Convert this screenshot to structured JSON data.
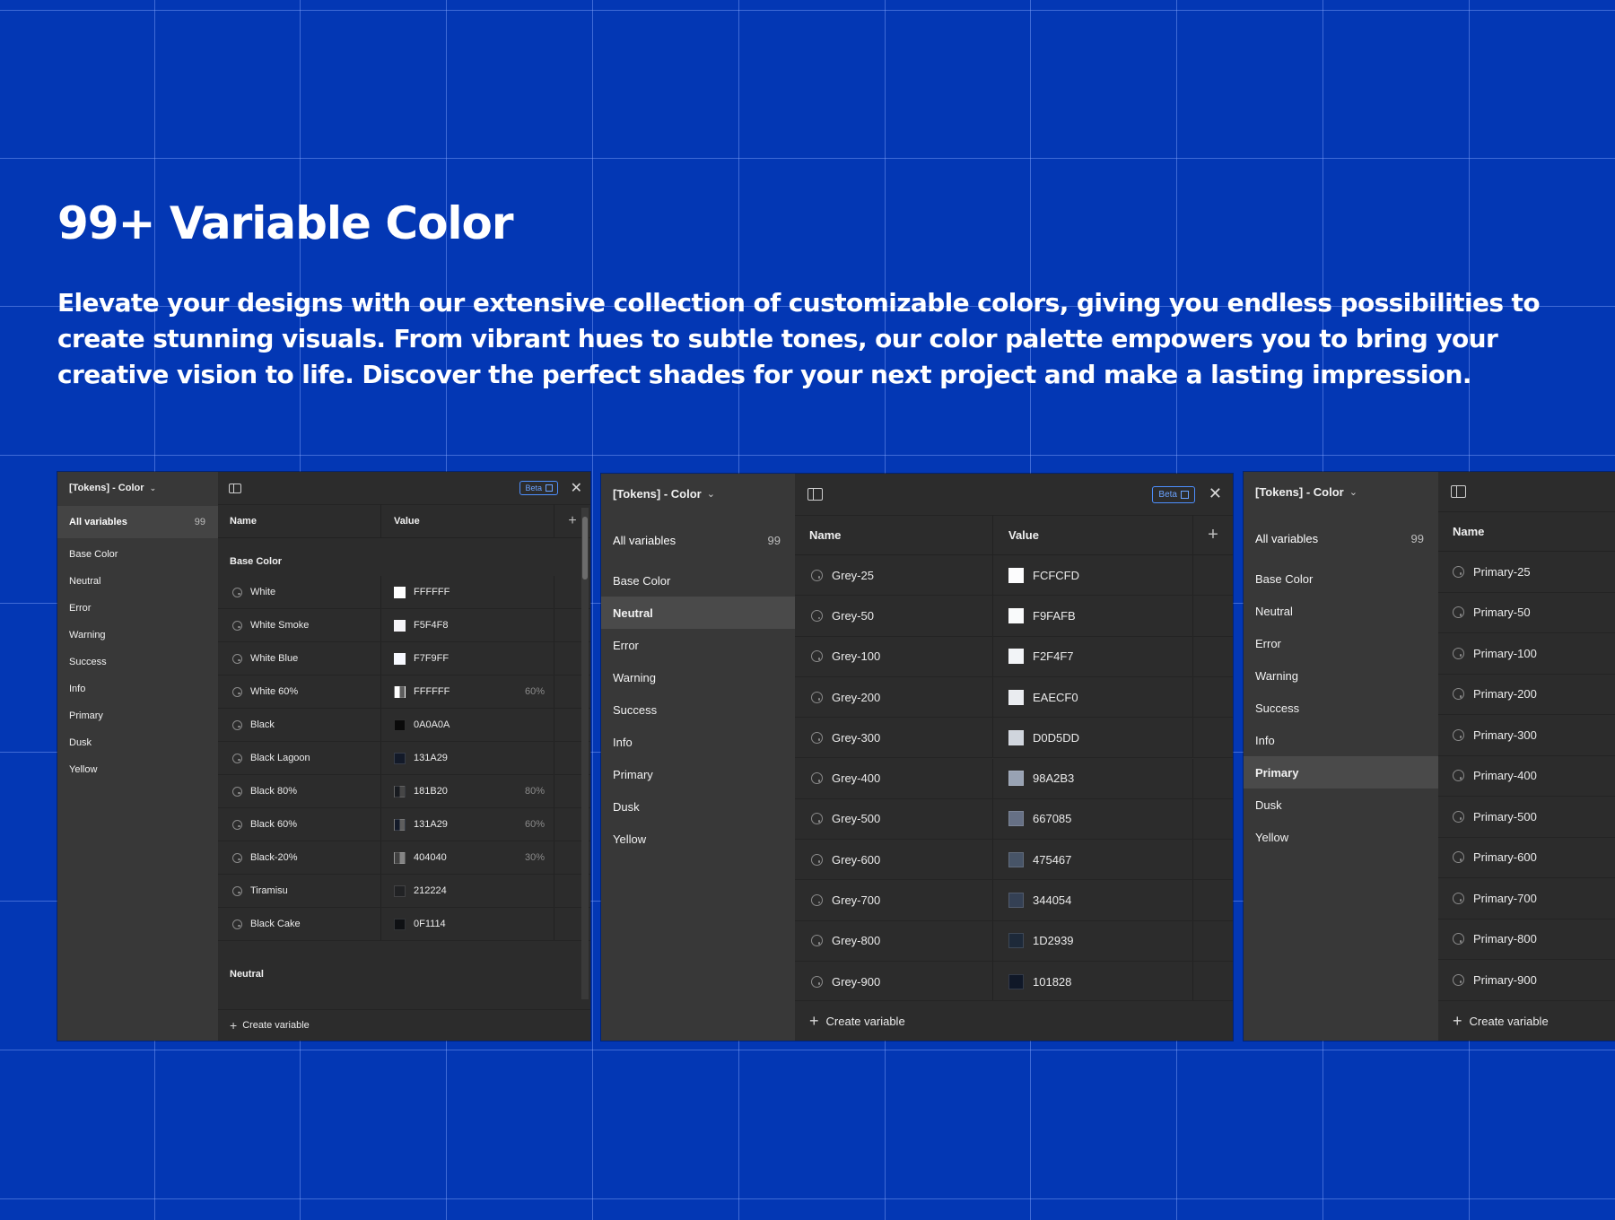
{
  "hero": {
    "title": "99+ Variable Color",
    "description": "Elevate your designs with our extensive collection of customizable colors, giving you endless possibilities to create stunning visuals. From vibrant hues to subtle tones, our color palette empowers you to bring your creative vision to life. Discover the perfect shades for your next project and make a lasting impression."
  },
  "colors": {
    "background": "#0337b4",
    "panel": "#2c2c2c",
    "sidebar": "#383838",
    "accent": "#4d8fff"
  },
  "panels": {
    "left": {
      "collection": "[Tokens] - Color",
      "all_variables": "All variables",
      "count": "99",
      "groups": [
        "Base Color",
        "Neutral",
        "Error",
        "Warning",
        "Success",
        "Info",
        "Primary",
        "Dusk",
        "Yellow"
      ],
      "beta": "Beta",
      "col_name": "Name",
      "col_value": "Value",
      "section": "Base Color",
      "next_section": "Neutral",
      "rows": [
        {
          "name": "White",
          "value": "FFFFFF",
          "color": "#FFFFFF",
          "pct": ""
        },
        {
          "name": "White Smoke",
          "value": "F5F4F8",
          "color": "#F5F4F8",
          "pct": ""
        },
        {
          "name": "White Blue",
          "value": "F7F9FF",
          "color": "#F7F9FF",
          "pct": ""
        },
        {
          "name": "White 60%",
          "value": "FFFFFF",
          "color": "#FFFFFF",
          "pct": "60%"
        },
        {
          "name": "Black",
          "value": "0A0A0A",
          "color": "#0A0A0A",
          "pct": ""
        },
        {
          "name": "Black Lagoon",
          "value": "131A29",
          "color": "#131A29",
          "pct": ""
        },
        {
          "name": "Black 80%",
          "value": "181B20",
          "color": "#181B20",
          "pct": "80%"
        },
        {
          "name": "Black 60%",
          "value": "131A29",
          "color": "#131A29",
          "pct": "60%"
        },
        {
          "name": "Black-20%",
          "value": "404040",
          "color": "#404040",
          "pct": "30%"
        },
        {
          "name": "Tiramisu",
          "value": "212224",
          "color": "#212224",
          "pct": ""
        },
        {
          "name": "Black Cake",
          "value": "0F1114",
          "color": "#0F1114",
          "pct": ""
        }
      ],
      "create": "Create variable"
    },
    "middle": {
      "collection": "[Tokens] - Color",
      "all_variables": "All variables",
      "count": "99",
      "groups": [
        "Base Color",
        "Neutral",
        "Error",
        "Warning",
        "Success",
        "Info",
        "Primary",
        "Dusk",
        "Yellow"
      ],
      "selected_group": "Neutral",
      "beta": "Beta",
      "col_name": "Name",
      "col_value": "Value",
      "rows": [
        {
          "name": "Grey-25",
          "value": "FCFCFD",
          "color": "#FCFCFD"
        },
        {
          "name": "Grey-50",
          "value": "F9FAFB",
          "color": "#F9FAFB"
        },
        {
          "name": "Grey-100",
          "value": "F2F4F7",
          "color": "#F2F4F7"
        },
        {
          "name": "Grey-200",
          "value": "EAECF0",
          "color": "#EAECF0"
        },
        {
          "name": "Grey-300",
          "value": "D0D5DD",
          "color": "#D0D5DD"
        },
        {
          "name": "Grey-400",
          "value": "98A2B3",
          "color": "#98A2B3"
        },
        {
          "name": "Grey-500",
          "value": "667085",
          "color": "#667085"
        },
        {
          "name": "Grey-600",
          "value": "475467",
          "color": "#475467"
        },
        {
          "name": "Grey-700",
          "value": "344054",
          "color": "#344054"
        },
        {
          "name": "Grey-800",
          "value": "1D2939",
          "color": "#1D2939"
        },
        {
          "name": "Grey-900",
          "value": "101828",
          "color": "#101828"
        }
      ],
      "create": "Create variable"
    },
    "right": {
      "collection": "[Tokens] - Color",
      "all_variables": "All variables",
      "count": "99",
      "groups": [
        "Base Color",
        "Neutral",
        "Error",
        "Warning",
        "Success",
        "Info",
        "Primary",
        "Dusk",
        "Yellow"
      ],
      "selected_group": "Primary",
      "col_name": "Name",
      "rows": [
        "Primary-25",
        "Primary-50",
        "Primary-100",
        "Primary-200",
        "Primary-300",
        "Primary-400",
        "Primary-500",
        "Primary-600",
        "Primary-700",
        "Primary-800",
        "Primary-900"
      ],
      "create": "Create variable"
    }
  }
}
